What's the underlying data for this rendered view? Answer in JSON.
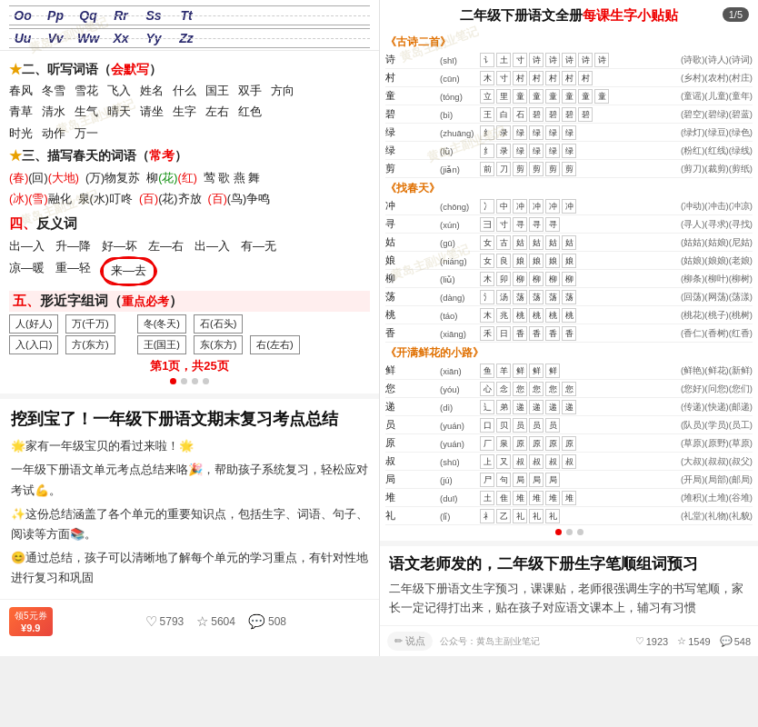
{
  "left": {
    "alphabet": {
      "rows": [
        [
          "Oo",
          "Pp",
          "Qq",
          "Rr",
          "Ss",
          "Tt"
        ],
        [
          "Uu",
          "Vv",
          "Ww",
          "Xx",
          "Yy",
          "Zz"
        ]
      ]
    },
    "section2": {
      "title": "★二、听写词语（会默写）",
      "rows": [
        [
          "春风",
          "冬雪",
          "雪花",
          "飞入",
          "姓名",
          "什么",
          "国王",
          "双手",
          "方向"
        ],
        [
          "青草",
          "清水",
          "生气",
          "晴天",
          "请坐",
          "生字",
          "左右",
          "红色"
        ],
        [
          "时光",
          "动作",
          "万一"
        ]
      ]
    },
    "section3": {
      "title": "★三、描写春天的词语（常考）",
      "rows": [
        "(春)(回)(大地)  (万)物复苏  柳绿(花)(红)  莺 歌 燕 舞",
        "(冰)(雪)融化  泉(水)叮咚  (百)(花)齐放  (百)(鸟)争鸣"
      ]
    },
    "section4": {
      "title": "四、反义词",
      "rows": [
        "出—入  升—降  好—坏  左—右  出—入  有—无",
        "凉—暖  重—轻  来—去"
      ]
    },
    "section5": {
      "title": "五、形近字组词（重点必考）",
      "rows": [
        {
          "left": "人(好人)",
          "mid": "万(千万)",
          "right1": "冬(冬天)",
          "right2": "石(石头)"
        },
        {
          "left": "入(入口)",
          "mid": "方(东方)",
          "right1": "王(国王)",
          "right2": "东(东方)",
          "right3": "右(左右)"
        }
      ]
    },
    "page_indicator": "第1页，共25页",
    "dots": [
      "active",
      "",
      "",
      ""
    ],
    "card": {
      "title": "挖到宝了！一年级下册语文期末复习考点总结",
      "body": [
        "🌟家有一年级宝贝的看过来啦！🌟",
        "一年级下册语文单元考点总结来咯🎉，帮助孩子系统复习，轻松应对考试💪。",
        "✨这份总结涵盖了各个单元的重要知识点，包括生字、词语、句子、阅读等方面📚。",
        "😊通过总结，孩子可以清晰地了解每个单元的学习重点，有针对性地进行复习和巩固"
      ]
    },
    "action_bar": {
      "coupon_label": "领5元券",
      "coupon_price": "¥9.9",
      "stats": [
        {
          "icon": "♡",
          "value": "5793"
        },
        {
          "icon": "☆",
          "value": "5604"
        },
        {
          "icon": "💬",
          "value": "508"
        }
      ]
    }
  },
  "right": {
    "badge": "1/5",
    "title_parts": [
      "二年级下册语文全册",
      "每课生字小贴贴"
    ],
    "sections": [
      {
        "name": "《古诗二首》",
        "chars": [
          {
            "char": "诗",
            "pinyin": "(shī)",
            "strokes": [
              "讠",
              "土",
              "寸"
            ],
            "words": "(诗歌)(诗人)(诗词)"
          },
          {
            "char": "村",
            "pinyin": "(cūn)",
            "strokes": [
              "木",
              "寸"
            ],
            "words": "(乡村)(农村)(村庄)"
          },
          {
            "char": "童",
            "pinyin": "(tóng)",
            "strokes": [
              "立",
              "里"
            ],
            "words": "(童谣)(儿童)(童年)"
          },
          {
            "char": "碧",
            "pinyin": "(bì)",
            "strokes": [
              "王",
              "白",
              "石"
            ],
            "words": "(碧空)(碧绿)(碧蓝)"
          },
          {
            "char": "绿",
            "pinyin": "(zhuāng)",
            "strokes": [
              "纟",
              "录"
            ],
            "words": "(绿灯)(绿豆)(绿色)"
          },
          {
            "char": "绿",
            "pinyin": "(lǜ)",
            "strokes": [
              "纟",
              "录"
            ],
            "words": "(粉红)(红线)(绿线)"
          },
          {
            "char": "剪",
            "pinyin": "(jiǎn)",
            "strokes": [
              "前",
              "刀"
            ],
            "words": "(剪刀)(裁剪)(剪纸)"
          }
        ]
      },
      {
        "name": "《找春天》",
        "chars": [
          {
            "char": "冲",
            "pinyin": "(chōng)",
            "strokes": [
              "冫",
              "中"
            ],
            "words": "(冲动)(冲击)(冲凉)"
          },
          {
            "char": "寻",
            "pinyin": "(xún)",
            "strokes": [
              "彐",
              "寸"
            ],
            "words": "(寻人)(寻求)(寻找)"
          },
          {
            "char": "姑",
            "pinyin": "(gū)",
            "strokes": [
              "女",
              "古"
            ],
            "words": "(姑姑)(姑娘)(尼姑)"
          },
          {
            "char": "娘",
            "pinyin": "(niáng)",
            "strokes": [
              "女",
              "良"
            ],
            "words": "(姑娘)(娘娘)(老娘)"
          },
          {
            "char": "柳",
            "pinyin": "(liǔ)",
            "strokes": [
              "木",
              "卯"
            ],
            "words": "(柳条)(柳叶)(柳树)"
          },
          {
            "char": "荡",
            "pinyin": "(dàng)",
            "strokes": [
              "氵",
              "汤"
            ],
            "words": "(回荡)(网荡)(荡漾)"
          },
          {
            "char": "桃",
            "pinyin": "(táo)",
            "strokes": [
              "木",
              "兆"
            ],
            "words": "(桃花)(桃子)(桃树)"
          },
          {
            "char": "香",
            "pinyin": "(xiāng)",
            "strokes": [
              "禾",
              "日"
            ],
            "words": "(香仁)(香树)(红香)"
          }
        ]
      },
      {
        "name": "《开满鲜花的小路》",
        "chars": [
          {
            "char": "鲜",
            "pinyin": "(xiān)",
            "strokes": [
              "鱼",
              "羊"
            ],
            "words": "(鲜艳)(鲜花)(新鲜)"
          },
          {
            "char": "您",
            "pinyin": "(yóu)",
            "strokes": [
              "心",
              "念"
            ],
            "words": "(您好)(问您)(您们)"
          },
          {
            "char": "递",
            "pinyin": "(dì)",
            "strokes": [
              "辶",
              "弟"
            ],
            "words": "(传递)(快递)(邮递)"
          },
          {
            "char": "员",
            "pinyin": "(yuán)",
            "strokes": [
              "口",
              "贝"
            ],
            "words": "(队员)(学员)(员工)"
          },
          {
            "char": "原",
            "pinyin": "(yuán)",
            "strokes": [
              "厂",
              "泉"
            ],
            "words": "(草原)(原野)(草原)"
          },
          {
            "char": "叔",
            "pinyin": "(shū)",
            "strokes": [
              "上",
              "又"
            ],
            "words": "(大叔)(叔叔)(叔父)"
          },
          {
            "char": "局",
            "pinyin": "(jú)",
            "strokes": [
              "尸",
              "句"
            ],
            "words": "(开局)(局部)(邮局)"
          },
          {
            "char": "堆",
            "pinyin": "(duī)",
            "strokes": [
              "土",
              "隹"
            ],
            "words": "(堆积)(土堆)(谷堆)"
          },
          {
            "char": "礼",
            "pinyin": "(lǐ)",
            "strokes": [
              "礻",
              "乙"
            ],
            "words": "(礼堂)(礼物)(礼貌)"
          }
        ]
      }
    ],
    "right_bottom": {
      "title": "语文老师发的，二年级下册生字笔顺组词预习",
      "body": "二年级下册语文生字预习，课课贴，老师很强调生字的书写笔顺，家长一定记得打出来，贴在孩子对应语文课本上，辅习有习惯"
    },
    "action_bar": {
      "edit_label": "✏ 说点",
      "source_label": "公众号：黄岛主副业笔记",
      "stats": [
        {
          "icon": "♡",
          "value": "1923"
        },
        {
          "icon": "☆",
          "value": "1549"
        },
        {
          "icon": "💬",
          "value": "548"
        }
      ]
    }
  }
}
